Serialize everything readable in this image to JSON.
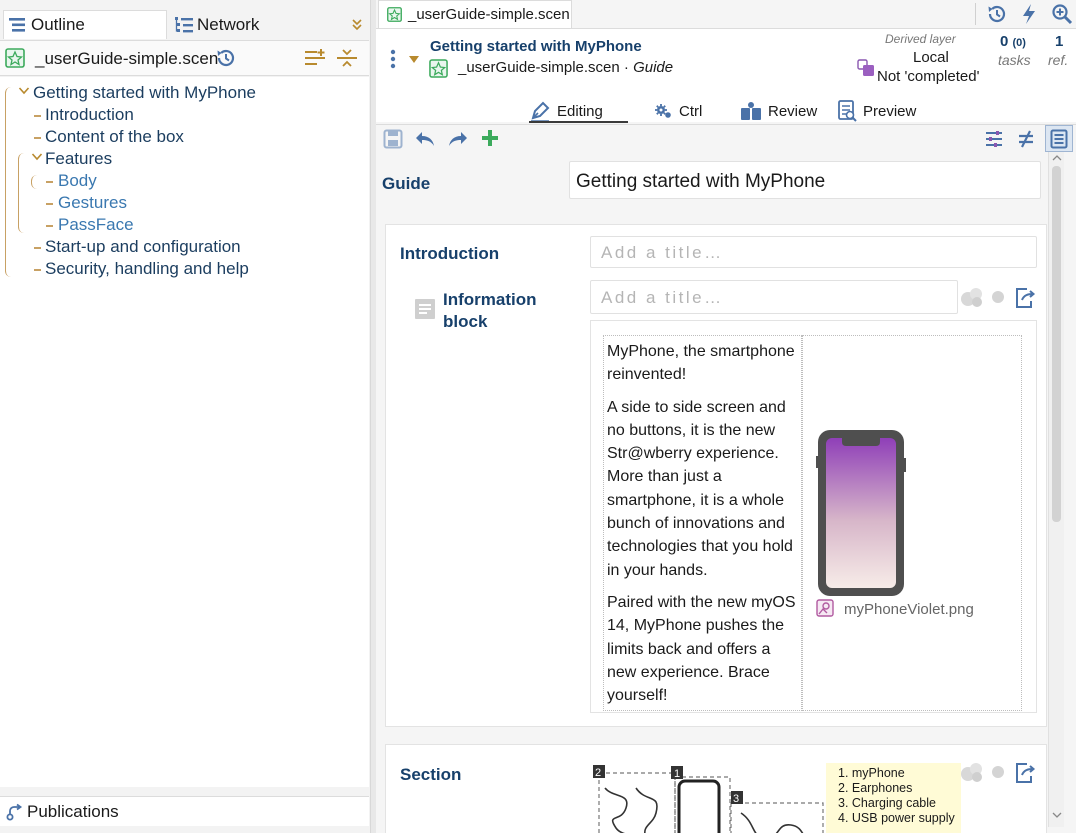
{
  "left_panel": {
    "tabs": {
      "outline": "Outline",
      "network": "Network"
    },
    "scenario_file": "_userGuide-simple.scen",
    "tree": [
      {
        "label": "Getting started with MyPhone",
        "level": 0,
        "expanded": true
      },
      {
        "label": "Introduction",
        "level": 1
      },
      {
        "label": "Content of the box",
        "level": 1
      },
      {
        "label": "Features",
        "level": 1,
        "expanded": true
      },
      {
        "label": "Body",
        "level": 2
      },
      {
        "label": "Gestures",
        "level": 2
      },
      {
        "label": "PassFace",
        "level": 2
      },
      {
        "label": "Start-up and configuration",
        "level": 1
      },
      {
        "label": "Security, handling and help",
        "level": 1
      }
    ],
    "publications_label": "Publications"
  },
  "right_panel": {
    "file_tab": "_userGuide-simple.scen",
    "header": {
      "doc_title": "Getting started with MyPhone",
      "file_name": "_userGuide-simple.scen",
      "model": "Guide",
      "separator": "·",
      "derived_layer_label": "Derived layer",
      "layer_value": "Local",
      "status": "Not 'completed'",
      "tasks_count": "0",
      "tasks_sub": "(0)",
      "tasks_label": "tasks",
      "ref_count": "1",
      "ref_label": "ref."
    },
    "view_tabs": {
      "editing": "Editing",
      "ctrl": "Ctrl",
      "review": "Review",
      "preview": "Preview"
    },
    "editor": {
      "guide_label": "Guide",
      "guide_title": "Getting started with MyPhone",
      "intro_label": "Introduction",
      "title_placeholder": "Add a title…",
      "info_block_label": "Information block",
      "paragraphs": [
        "MyPhone, the smartphone reinvented!",
        "A side to side screen and no buttons, it is the new Str@wberry experience. More than just a smartphone, it is a whole bunch of innovations and technologies that you hold in your hands.",
        "Paired with the new myOS 14, MyPhone pushes the limits back and offers a new experience. Brace yourself!"
      ],
      "image_name": "myPhoneViolet.png",
      "section_label": "Section",
      "box_contents": [
        "1. myPhone",
        "2. Earphones",
        "3. Charging cable",
        "4. USB power supply"
      ]
    }
  },
  "colors": {
    "accent": "#17406b",
    "dash": "#c8a164",
    "green": "#3caa5c",
    "iconblue": "#4a72a8"
  }
}
